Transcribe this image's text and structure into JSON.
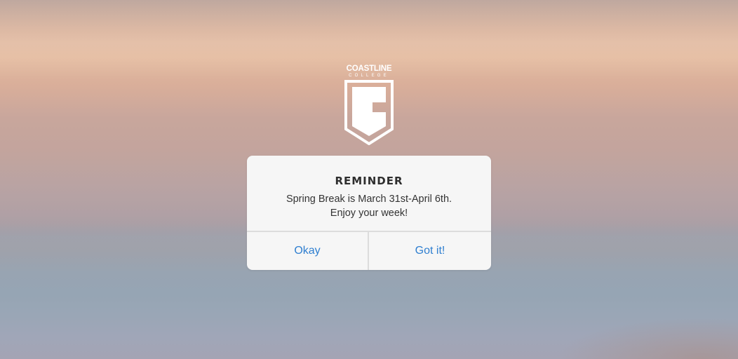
{
  "logo": {
    "wordmark": "COASTLINE",
    "subtext": "COLLEGE"
  },
  "dialog": {
    "title": "REMINDER",
    "message_line1": "Spring Break is March 31st-April 6th.",
    "message_line2": "Enjoy your week!",
    "buttons": {
      "okay": "Okay",
      "got_it": "Got it!"
    }
  },
  "colors": {
    "button_text": "#2f7fd0",
    "dialog_bg": "#f6f6f6"
  }
}
